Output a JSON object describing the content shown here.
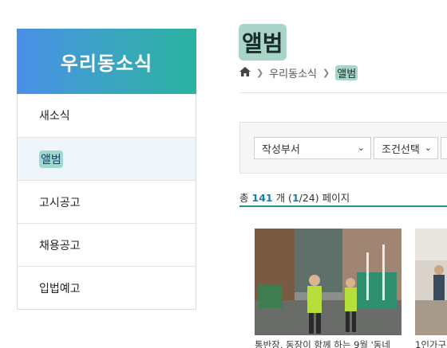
{
  "sidebar": {
    "title": "우리동소식",
    "items": [
      {
        "label": "새소식"
      },
      {
        "label": "앨범"
      },
      {
        "label": "고시공고"
      },
      {
        "label": "채용공고"
      },
      {
        "label": "입법예고"
      }
    ]
  },
  "main": {
    "title": "앨범",
    "breadcrumb": [
      "우리동소식",
      "앨범"
    ],
    "filters": {
      "dept": "작성부서",
      "condition": "조건선택"
    },
    "total": {
      "prefix": "총",
      "count": "141",
      "unit": "개 (",
      "page": "1",
      "pages": "/24) 페이지"
    },
    "gallery": [
      {
        "caption": "통반장, 동장이 함께 하는 9월 '동네"
      },
      {
        "caption": "1인가구"
      }
    ]
  },
  "colors": {
    "header_gradient_start": "#4a8fe6",
    "header_gradient_end": "#2bb3a0",
    "highlight": "#a8d5c8",
    "accent": "#2d8b88",
    "count": "#1f7ea6"
  }
}
